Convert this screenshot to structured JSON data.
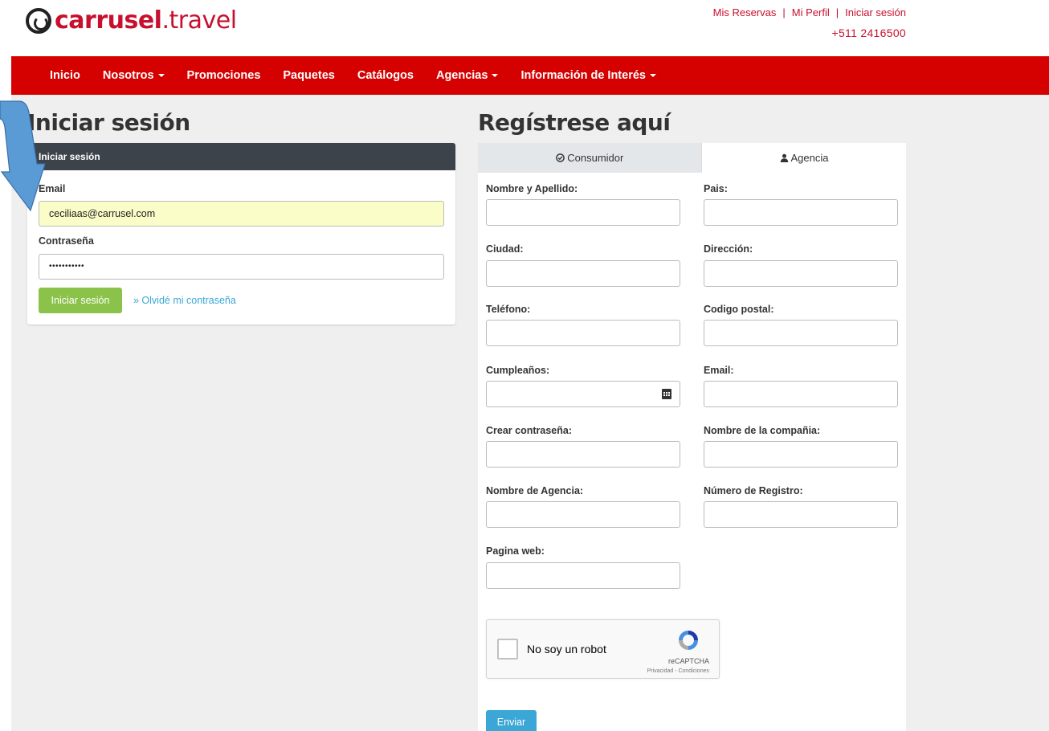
{
  "header": {
    "logo_bold": "carrusel",
    "logo_light": ".travel",
    "links": [
      "Mis Reservas",
      "Mi Perfil",
      "Iniciar sesión"
    ],
    "phone": "+511 2416500"
  },
  "nav": {
    "items": [
      {
        "label": "Inicio",
        "dropdown": false
      },
      {
        "label": "Nosotros",
        "dropdown": true
      },
      {
        "label": "Promociones",
        "dropdown": false
      },
      {
        "label": "Paquetes",
        "dropdown": false
      },
      {
        "label": "Catálogos",
        "dropdown": false
      },
      {
        "label": "Agencias",
        "dropdown": true
      },
      {
        "label": "Información de Interés",
        "dropdown": true
      }
    ]
  },
  "login": {
    "heading": "Iniciar sesión",
    "panel_title": "Iniciar sesión",
    "email_label": "Email",
    "email_value": "ceciliaas@carrusel.com",
    "password_label": "Contraseña",
    "password_value": "•••••••••••",
    "submit_label": "Iniciar sesión",
    "forgot_label": "» Olvidé mi contraseña"
  },
  "register": {
    "heading": "Regístrese aquí",
    "tabs": [
      {
        "label": "Consumidor",
        "icon": "check-circle-icon",
        "active": false
      },
      {
        "label": "Agencia",
        "icon": "user-icon",
        "active": true
      }
    ],
    "fields_left": [
      "Nombre y Apellido:",
      "Ciudad:",
      "Teléfono:",
      "Cumpleaños:",
      "Crear contraseña:",
      "Nombre de Agencia:",
      "Pagina web:"
    ],
    "fields_right": [
      "Pais:",
      "Dirección:",
      "Codigo postal:",
      "Email:",
      "Nombre de la compañia:",
      "Número de Registro:"
    ],
    "captcha_label": "No soy un robot",
    "captcha_brand": "reCAPTCHA",
    "captcha_terms": "Privacidad - Condiciones",
    "submit_label": "Enviar"
  },
  "colors": {
    "brand_red": "#d50000",
    "login_button": "#8bc34a",
    "submit_button": "#3ba7d6",
    "panel_header": "#3d434b",
    "annotation_arrow": "#5b9bd5"
  }
}
